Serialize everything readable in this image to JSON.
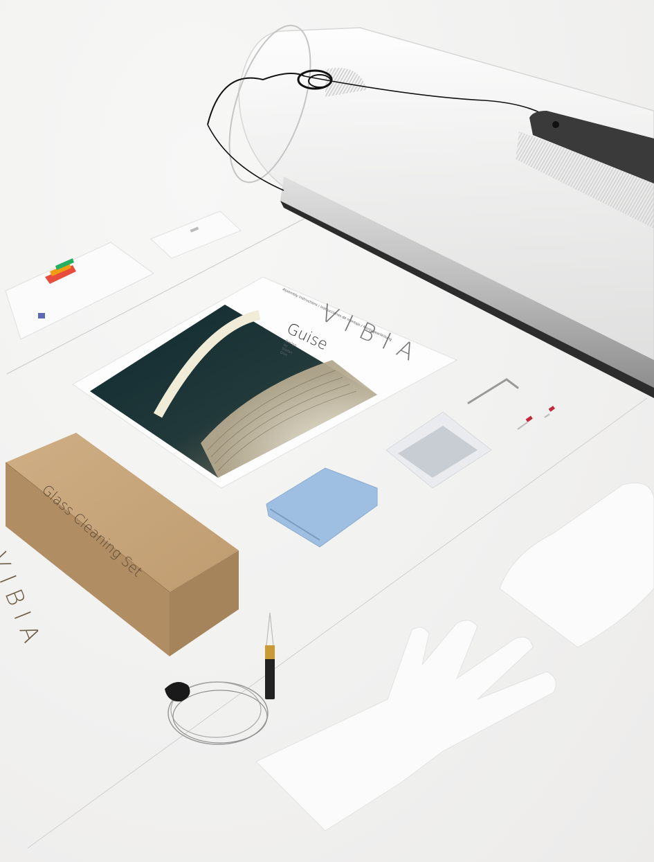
{
  "booklet": {
    "brand": "VIBIA",
    "subtitle": "Assembly instructions / Instrucciones de montaje / Montageanleitung",
    "product_name": "Guise",
    "designer": "Design by Stefan Diez"
  },
  "cleaning_box": {
    "label": "Glass Cleaning Set",
    "brand": "VIBIA"
  },
  "colors": {
    "background": "#f2f2f1",
    "cardboard": "#c9a77e",
    "cloth": "#9fbfe2",
    "canopy": "#3a3a3a",
    "photo_dark": "#143036"
  },
  "icons": [
    "lamp-shade",
    "ceiling-canopy",
    "label-card",
    "energy-label",
    "instruction-booklet",
    "allen-key",
    "wire-ferrules",
    "hardware-bag",
    "microfiber-cloth",
    "cardboard-box",
    "suspension-cable",
    "cotton-glove"
  ]
}
